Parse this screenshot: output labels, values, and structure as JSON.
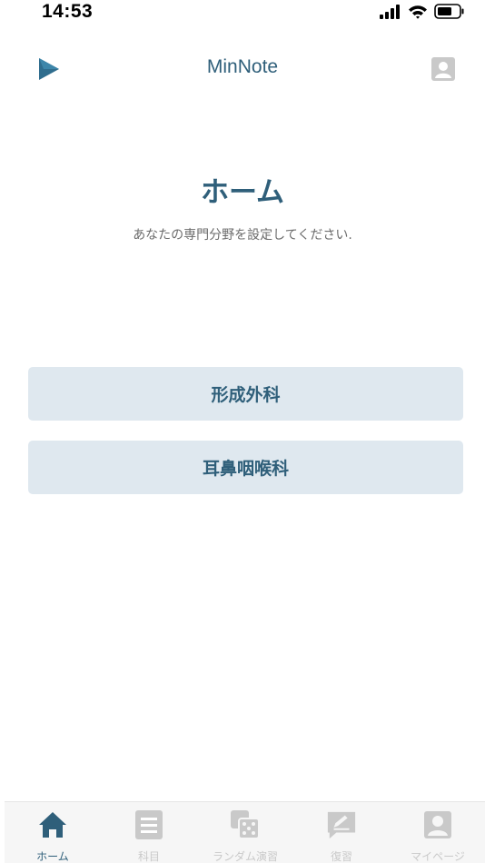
{
  "status_bar": {
    "time": "14:53"
  },
  "nav": {
    "title": "MinNote",
    "left_icon": "play-icon",
    "right_icon": "profile-icon"
  },
  "page": {
    "title": "ホーム",
    "subtitle": "あなたの専門分野を設定してください."
  },
  "specialties": [
    {
      "label": "形成外科"
    },
    {
      "label": "耳鼻咽喉科"
    }
  ],
  "tab_bar": {
    "items": [
      {
        "label": "ホーム",
        "icon": "home-icon",
        "active": true
      },
      {
        "label": "科目",
        "icon": "list-icon",
        "active": false
      },
      {
        "label": "ランダム演習",
        "icon": "dice-icon",
        "active": false
      },
      {
        "label": "復習",
        "icon": "review-icon",
        "active": false
      },
      {
        "label": "マイページ",
        "icon": "profile-icon",
        "active": false
      }
    ]
  },
  "colors": {
    "accent": "#2f5f7a",
    "button_bg": "#dfe8ef",
    "inactive": "#c9c9c9",
    "tab_bg": "#f6f6f6"
  }
}
